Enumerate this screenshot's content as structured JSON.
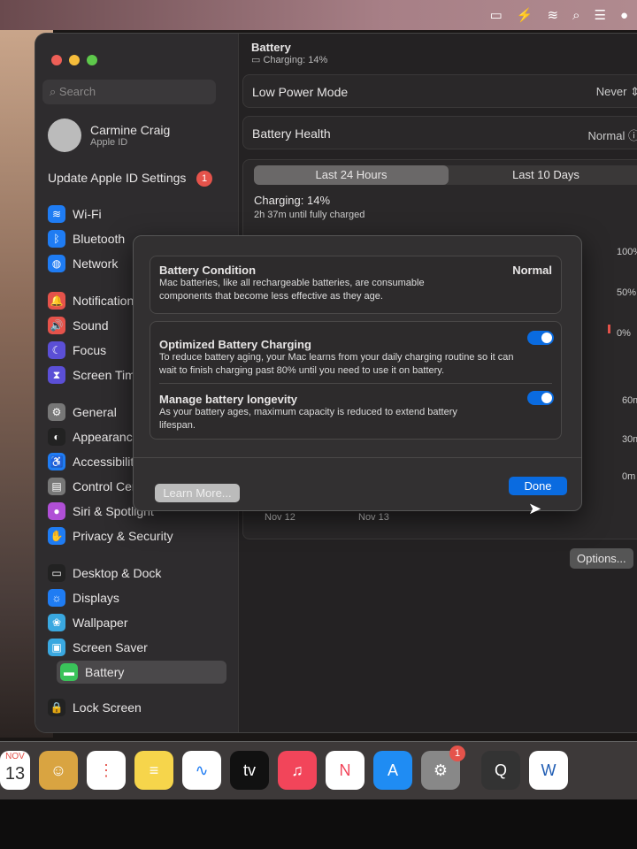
{
  "menubar": {
    "icons": [
      "display-icon",
      "battery-charging-icon",
      "wifi-icon",
      "search-icon",
      "control-center-icon",
      "siri-icon"
    ]
  },
  "sidebar": {
    "search_placeholder": "Search",
    "user_name": "Carmine Craig",
    "user_sub": "Apple ID",
    "update_label": "Update Apple ID Settings",
    "update_badge": "1",
    "items": [
      {
        "label": "Wi-Fi",
        "color": "#1f7cf3",
        "glyph": "≋"
      },
      {
        "label": "Bluetooth",
        "color": "#1f7cf3",
        "glyph": "ᛒ"
      },
      {
        "label": "Network",
        "color": "#1f7cf3",
        "glyph": "◍"
      },
      {
        "label": "Notifications",
        "color": "#e5534b",
        "glyph": "🔔"
      },
      {
        "label": "Sound",
        "color": "#e5534b",
        "glyph": "🔊"
      },
      {
        "label": "Focus",
        "color": "#5b4fd6",
        "glyph": "☾"
      },
      {
        "label": "Screen Time",
        "color": "#5b4fd6",
        "glyph": "⧗"
      },
      {
        "label": "General",
        "color": "#777",
        "glyph": "⚙"
      },
      {
        "label": "Appearance",
        "color": "#222",
        "glyph": "◐"
      },
      {
        "label": "Accessibility",
        "color": "#1f7cf3",
        "glyph": "♿"
      },
      {
        "label": "Control Centre",
        "color": "#777",
        "glyph": "▤"
      },
      {
        "label": "Siri & Spotlight",
        "color": "#b04fd6",
        "glyph": "●"
      },
      {
        "label": "Privacy & Security",
        "color": "#1f7cf3",
        "glyph": "✋"
      },
      {
        "label": "Desktop & Dock",
        "color": "#222",
        "glyph": "▭"
      },
      {
        "label": "Displays",
        "color": "#1f7cf3",
        "glyph": "☼"
      },
      {
        "label": "Wallpaper",
        "color": "#3aa8e0",
        "glyph": "❀"
      },
      {
        "label": "Screen Saver",
        "color": "#3aa8e0",
        "glyph": "▣"
      },
      {
        "label": "Battery",
        "color": "#3ac35a",
        "glyph": "▬"
      },
      {
        "label": "Lock Screen",
        "color": "#222",
        "glyph": "🔒"
      }
    ]
  },
  "main": {
    "title": "Battery",
    "subtitle": "Charging: 14%",
    "low_power_label": "Low Power Mode",
    "low_power_value": "Never",
    "health_label": "Battery Health",
    "health_value": "Normal",
    "tabs": [
      "Last 24 Hours",
      "Last 10 Days"
    ],
    "charging": "Charging: 14%",
    "until_full": "2h 37m until fully charged",
    "y_level": [
      "100%",
      "50%",
      "0%"
    ],
    "y_usage": [
      "60m",
      "30m",
      "0m"
    ],
    "x_labels": [
      "Nov 12",
      "Nov 13"
    ],
    "options": "Options..."
  },
  "modal": {
    "condition_title": "Battery Condition",
    "condition_value": "Normal",
    "condition_desc": "Mac batteries, like all rechargeable batteries, are consumable components that become less effective as they age.",
    "optimized_title": "Optimized Battery Charging",
    "optimized_desc": "To reduce battery aging, your Mac learns from your daily charging routine so it can wait to finish charging past 80% until you need to use it on battery.",
    "optimized_on": true,
    "longevity_title": "Manage battery longevity",
    "longevity_desc": "As your battery ages, maximum capacity is reduced to extend battery lifespan.",
    "longevity_on": true,
    "learn_more": "Learn More...",
    "done": "Done"
  },
  "dock": {
    "calendar_month": "NOV",
    "calendar_day": "13",
    "settings_badge": "1",
    "apps": [
      "calendar",
      "contacts",
      "reminders",
      "notes",
      "freeform",
      "tv",
      "music",
      "news",
      "app-store",
      "system-settings",
      "quicktime",
      "word"
    ]
  }
}
